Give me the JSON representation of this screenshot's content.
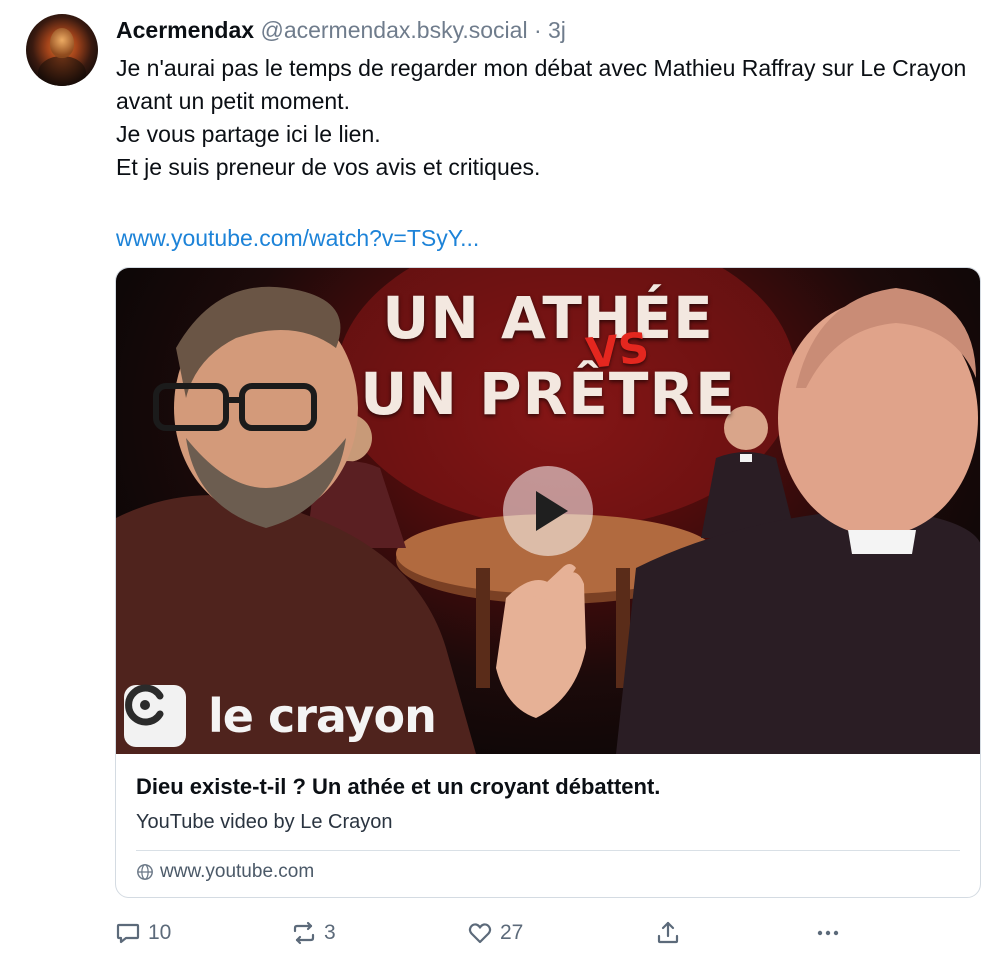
{
  "author": {
    "display_name": "Acermendax",
    "handle": "@acermendax.bsky.social",
    "separator": "·",
    "time": "3j"
  },
  "post": {
    "lines": [
      "Je n'aurai pas le temps de regarder mon débat avec Mathieu Raffray sur Le Crayon avant un petit moment.",
      "Je vous partage ici le lien.",
      "Et je suis preneur de vos avis et critiques."
    ],
    "link_text": "www.youtube.com/watch?v=TSyY..."
  },
  "embed": {
    "thumbnail": {
      "headline_line1": "UN ATHÉE",
      "vs": "VS",
      "headline_line2": "UN PRÊTRE",
      "brand_name": "le crayon"
    },
    "title": "Dieu existe-t-il ? Un athée et un croyant débattent.",
    "description": "YouTube video by Le Crayon",
    "domain": "www.youtube.com"
  },
  "actions": {
    "reply_count": "10",
    "repost_count": "3",
    "like_count": "27"
  },
  "icons": {
    "reply": "speech-bubble-icon",
    "repost": "repost-arrows-icon",
    "like": "heart-icon",
    "share": "share-upload-icon",
    "more": "more-dots-icon",
    "play": "play-icon",
    "domain": "globe-icon"
  },
  "colors": {
    "link": "#1d83d8",
    "muted": "#6f7c8c",
    "headline_red": "#e4271f"
  }
}
